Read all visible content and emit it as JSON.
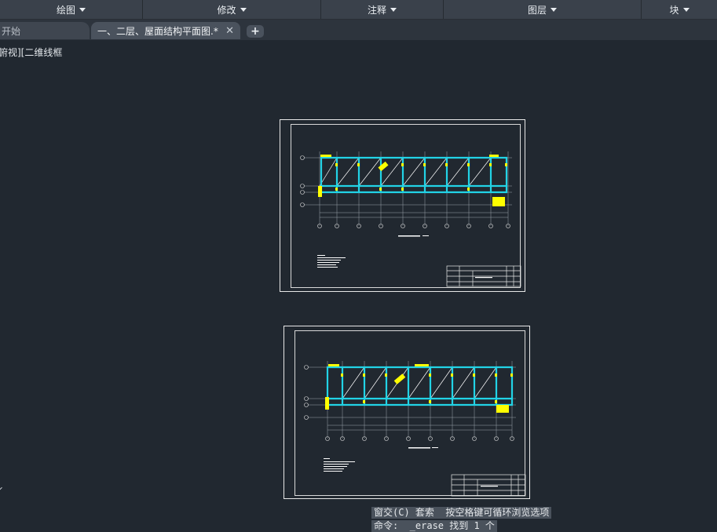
{
  "menubar": {
    "items": [
      {
        "label": "绘图"
      },
      {
        "label": "修改"
      },
      {
        "label": "注释"
      },
      {
        "label": "图层"
      },
      {
        "label": "块"
      }
    ]
  },
  "tabs": {
    "start_label": "开始",
    "active_label": "一、二层、屋面结构平面图.*",
    "close_symbol": "✕",
    "add_symbol": "+"
  },
  "viewport": {
    "label": "俯视][二维线框"
  },
  "command": {
    "prompt_line": "窗交(C) 套索  按空格键可循环浏览选项",
    "history_line": "命令:  _erase 找到 1 个"
  },
  "colors": {
    "background": "#212830",
    "beam": "#22d3e6",
    "column": "#ffff00",
    "sheet_border": "#e8e8e8"
  }
}
